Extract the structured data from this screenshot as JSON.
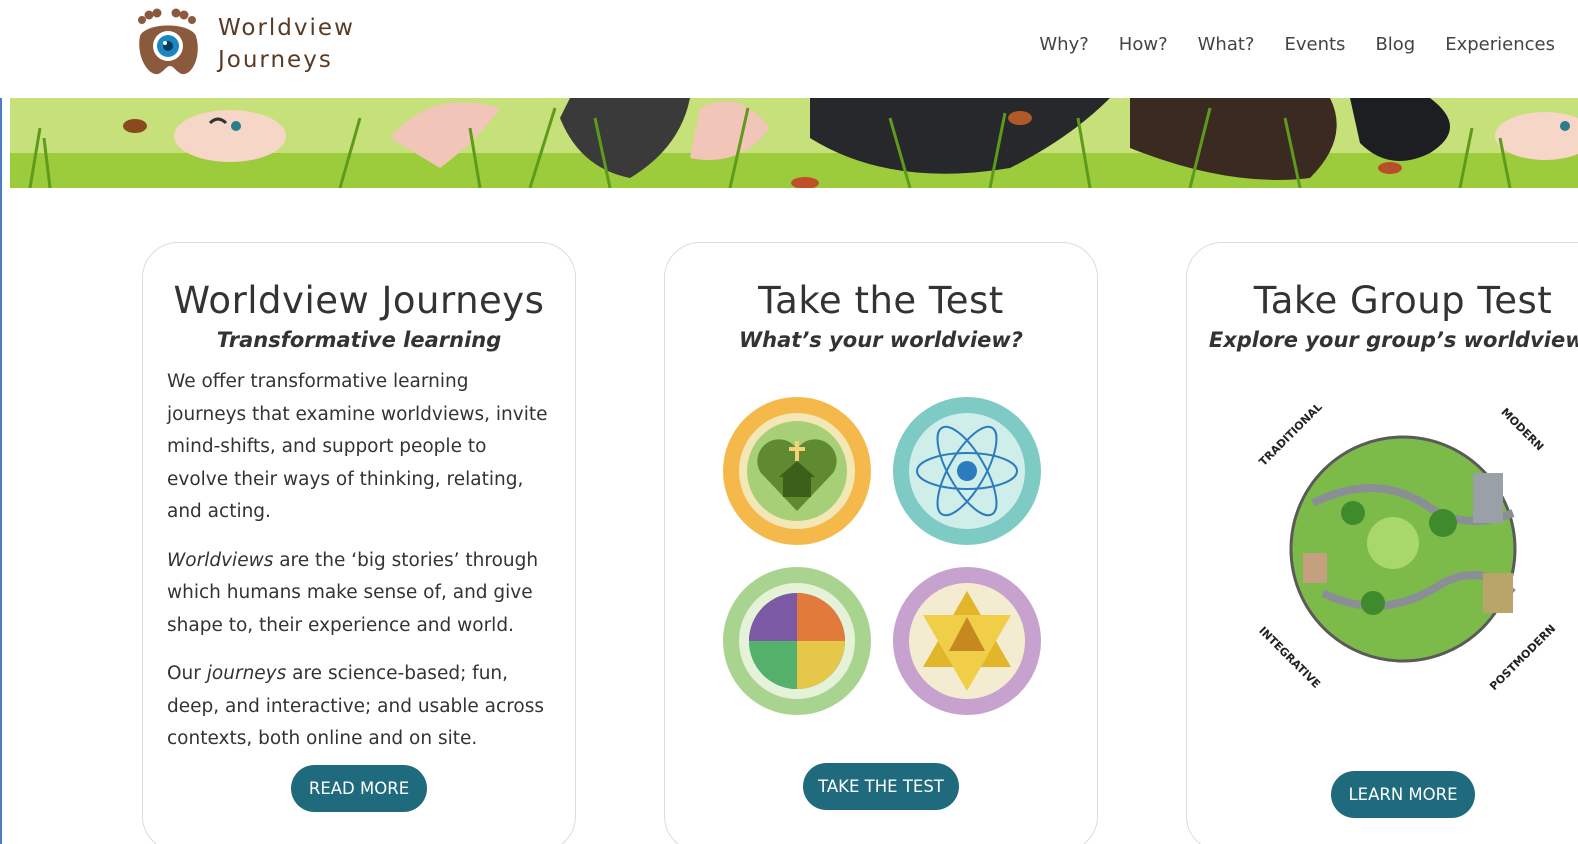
{
  "brand": {
    "name_line1": "Worldview",
    "name_line2": "Journeys"
  },
  "nav": {
    "items": [
      "Why?",
      "How?",
      "What?",
      "Events",
      "Blog",
      "Experiences"
    ]
  },
  "cards": [
    {
      "title": "Worldview Journeys",
      "subtitle": "Transformative learning",
      "p1": "We offer transformative learning journeys that examine worldviews, invite mind-shifts, and support people to evolve their ways of thinking, relating, and acting.",
      "p2_em": "Worldviews",
      "p2_rest": " are the ‘big stories’ through which humans make sense of, and give shape to, their experience and world.",
      "p3_pre": "Our ",
      "p3_em": "journeys",
      "p3_rest": " are science-based; fun, deep, and interactive; and usable across contexts, both online and on site.",
      "button": "READ MORE"
    },
    {
      "title": "Take the Test",
      "subtitle": "What’s your worldview?",
      "button": "TAKE THE TEST"
    },
    {
      "title": "Take Group Test",
      "subtitle": "Explore your group’s worldviews",
      "globe_labels": [
        "TRADITIONAL",
        "MODERN",
        "POSTMODERN",
        "INTEGRATIVE"
      ],
      "button": "LEARN MORE"
    }
  ],
  "colors": {
    "button": "#1f6b7d",
    "banner_green": "#9ccc3c",
    "brand_brown": "#5a3a25"
  }
}
